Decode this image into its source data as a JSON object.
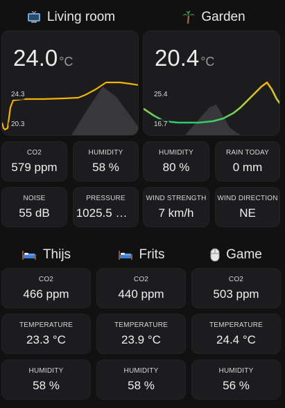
{
  "sections": {
    "living_room": {
      "title": "Living room",
      "icon": "tv-icon"
    },
    "garden": {
      "title": "Garden",
      "icon": "palm-tree-icon"
    },
    "thijs": {
      "title": "Thijs",
      "icon": "bed-icon"
    },
    "frits": {
      "title": "Frits",
      "icon": "bed-icon"
    },
    "game": {
      "title": "Game",
      "icon": "mouse-icon"
    }
  },
  "living_room_graph": {
    "value": "24.0",
    "unit": "°C",
    "max_label": "24.3",
    "min_label": "20.3",
    "line_color": "#f5b400"
  },
  "garden_graph": {
    "value": "20.4",
    "unit": "°C",
    "max_label": "25.4",
    "min_label": "16.7",
    "line_colors": [
      "#2ecc71",
      "#f5b400"
    ]
  },
  "living_room_tiles": [
    {
      "label": "CO2",
      "value": "579 ppm"
    },
    {
      "label": "HUMIDITY",
      "value": "58 %"
    },
    {
      "label": "NOISE",
      "value": "55 dB"
    },
    {
      "label": "PRESSURE",
      "value": "1025.5 m…"
    }
  ],
  "garden_tiles": [
    {
      "label": "HUMIDITY",
      "value": "80 %"
    },
    {
      "label": "RAIN TODAY",
      "value": "0 mm"
    },
    {
      "label": "WIND STRENGTH",
      "value": "7 km/h"
    },
    {
      "label": "WIND DIRECTION",
      "value": "NE"
    }
  ],
  "rooms": {
    "thijs": [
      {
        "label": "CO2",
        "value": "466 ppm"
      },
      {
        "label": "TEMPERATURE",
        "value": "23.3 °C"
      },
      {
        "label": "HUMIDITY",
        "value": "58 %"
      }
    ],
    "frits": [
      {
        "label": "CO2",
        "value": "440 ppm"
      },
      {
        "label": "TEMPERATURE",
        "value": "23.9 °C"
      },
      {
        "label": "HUMIDITY",
        "value": "58 %"
      }
    ],
    "game": [
      {
        "label": "CO2",
        "value": "503 ppm"
      },
      {
        "label": "TEMPERATURE",
        "value": "24.4 °C"
      },
      {
        "label": "HUMIDITY",
        "value": "56 %"
      }
    ]
  }
}
